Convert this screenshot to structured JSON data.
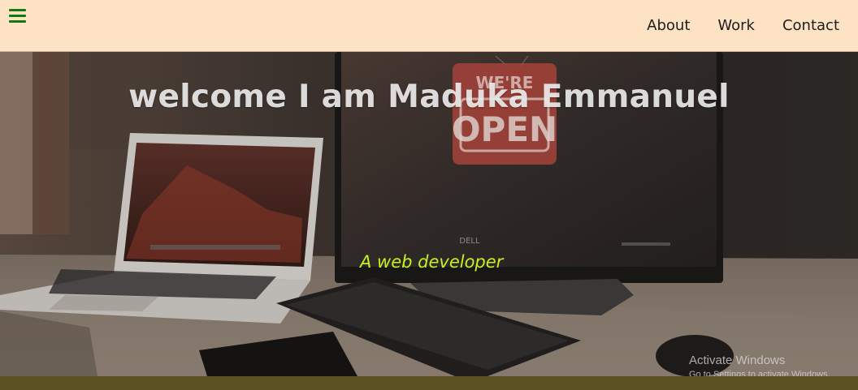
{
  "header": {
    "menu_icon": "hamburger-menu-icon",
    "nav": [
      {
        "label": "About"
      },
      {
        "label": "Work"
      },
      {
        "label": "Contact"
      }
    ]
  },
  "hero": {
    "title": "welcome I am Maduka Emmanuel",
    "subtitle": "A web developer",
    "photo_sign_text": "OPEN",
    "photo_sign_top_text": "WE'RE",
    "photo_monitor_brand": "DELL"
  },
  "watermark": {
    "title": "Activate Windows",
    "subtitle": "Go to Settings to activate Windows."
  },
  "colors": {
    "header_bg": "#fde2c4",
    "menu_icon": "#137a13",
    "subtitle": "#c4f024",
    "bottom_strip": "#5b5021"
  }
}
